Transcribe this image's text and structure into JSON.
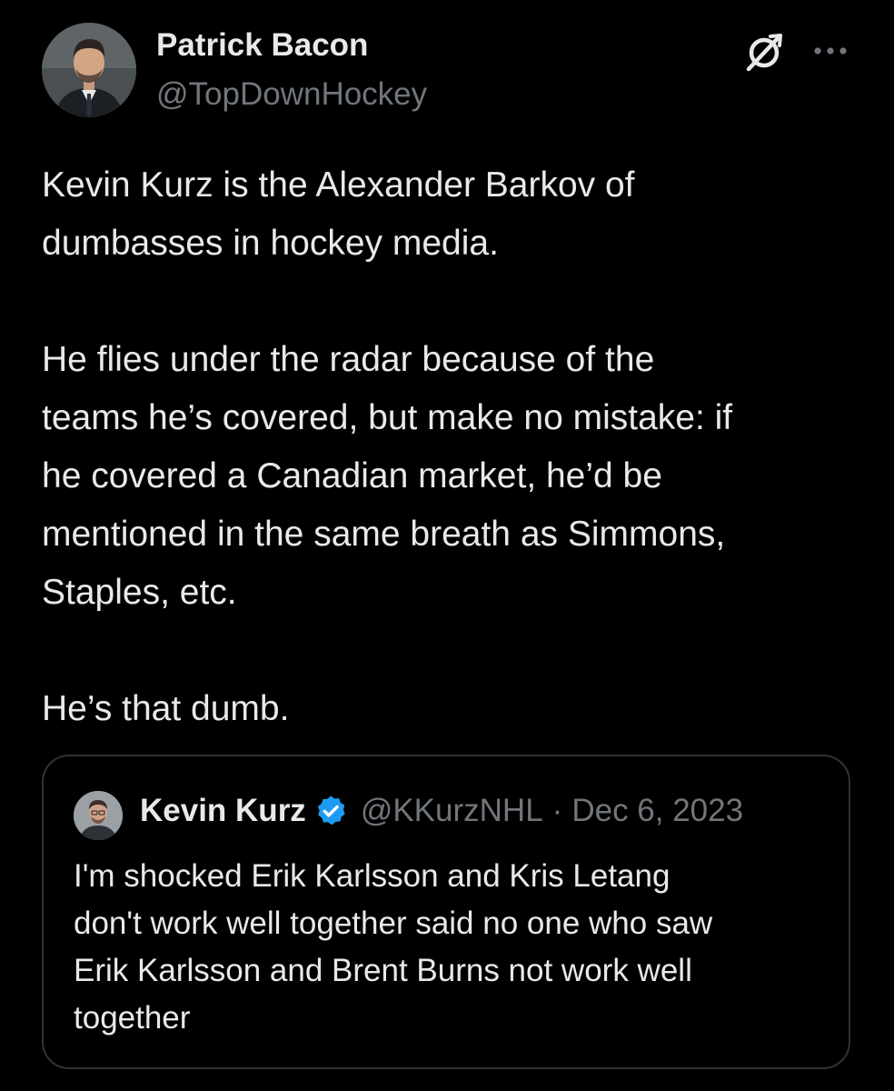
{
  "author": {
    "display_name": "Patrick Bacon",
    "handle": "@TopDownHockey",
    "avatar_icon": "person-avatar"
  },
  "header_icons": {
    "grok": "grok-icon",
    "more": "more-options-icon"
  },
  "tweet": {
    "paragraphs": [
      {
        "lines": [
          "Kevin Kurz is the Alexander Barkov of",
          "dumbasses in hockey media."
        ]
      },
      {
        "lines": [
          "He flies under the radar because of the",
          "teams he’s covered, but make no mistake: if",
          "he covered a Canadian market, he’d be",
          "mentioned in the same breath as Simmons,",
          "Staples, etc."
        ]
      },
      {
        "lines": [
          "He’s that dumb."
        ]
      }
    ]
  },
  "quoted_tweet": {
    "display_name": "Kevin Kurz",
    "verified": true,
    "handle": "@KKurzNHL",
    "separator": "·",
    "date": "Dec 6, 2023",
    "lines": [
      "I'm shocked Erik Karlsson and Kris Letang",
      "don't work well together said no one who saw",
      "Erik Karlsson and Brent Burns not work well",
      "together"
    ]
  },
  "colors": {
    "background": "#000000",
    "text_primary": "#e7e9ea",
    "text_secondary": "#71767b",
    "border": "#2f3336",
    "verified_blue": "#1d9bf0"
  }
}
